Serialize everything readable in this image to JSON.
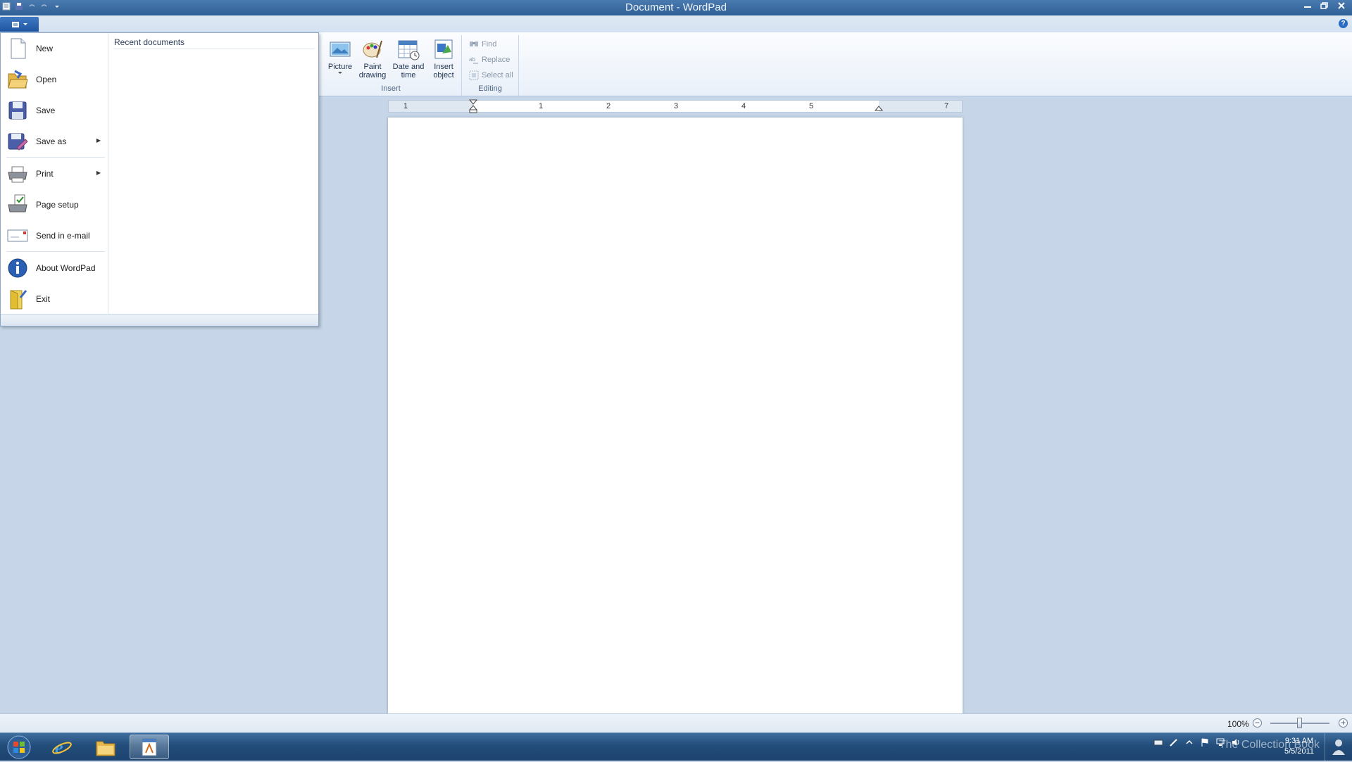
{
  "window": {
    "title": "Document - WordPad"
  },
  "ribbon": {
    "insert_group": {
      "label": "Insert",
      "buttons": [
        {
          "label": "Picture",
          "icon": "picture-icon"
        },
        {
          "label": "Paint drawing",
          "icon": "paint-drawing-icon"
        },
        {
          "label": "Date and time",
          "icon": "date-time-icon"
        },
        {
          "label": "Insert object",
          "icon": "insert-object-icon"
        }
      ]
    },
    "editing_group": {
      "label": "Editing",
      "buttons": [
        {
          "label": "Find",
          "icon": "find-icon"
        },
        {
          "label": "Replace",
          "icon": "replace-icon"
        },
        {
          "label": "Select all",
          "icon": "select-all-icon"
        }
      ]
    }
  },
  "ruler": {
    "labels": [
      "1",
      "1",
      "2",
      "3",
      "4",
      "5",
      "7"
    ]
  },
  "file_menu": {
    "items": [
      {
        "label": "New",
        "icon": "new-document-icon"
      },
      {
        "label": "Open",
        "icon": "open-folder-icon"
      },
      {
        "label": "Save",
        "icon": "save-disk-icon"
      },
      {
        "label": "Save as",
        "icon": "save-as-icon"
      },
      {
        "label": "Print",
        "icon": "printer-icon"
      },
      {
        "label": "Page setup",
        "icon": "page-setup-icon"
      },
      {
        "label": "Send in e-mail",
        "icon": "email-icon"
      },
      {
        "label": "About WordPad",
        "icon": "info-icon"
      },
      {
        "label": "Exit",
        "icon": "exit-icon"
      }
    ],
    "recent_header": "Recent documents"
  },
  "statusbar": {
    "zoom_label": "100%",
    "zoom_value_percent": 100
  },
  "taskbar": {
    "clock_time": "9:31 AM",
    "clock_date": "5/5/2011",
    "watermark": "The Collection Book"
  },
  "colors": {
    "accent": "#1f55a0",
    "ribbon_bg": "#e9f0f9",
    "workspace_bg": "#c6d6e8",
    "taskbar": "#234d7a"
  }
}
